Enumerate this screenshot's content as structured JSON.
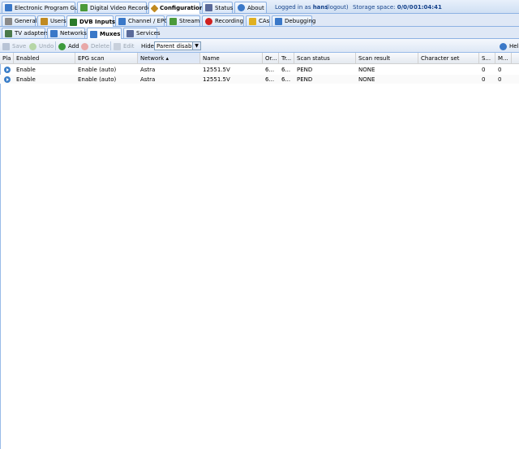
{
  "top_tabs": [
    {
      "label": "Electronic Program Guide",
      "icon": "epg-icon",
      "color": "#3a78c8"
    },
    {
      "label": "Digital Video Recorder",
      "icon": "dvr-icon",
      "color": "#4a9a3a"
    },
    {
      "label": "Configuration",
      "icon": "wrench-icon",
      "color": "#c08a20",
      "active": true
    },
    {
      "label": "Status",
      "icon": "status-icon",
      "color": "#5a6a9a"
    },
    {
      "label": "About",
      "icon": "info-icon",
      "color": "#3a78c8"
    }
  ],
  "login": {
    "prefix": "Logged in as",
    "user": "hans",
    "logout": "(logout)"
  },
  "storage": {
    "label": "Storage space:",
    "value": "0/0/0",
    "time": "01:04:41"
  },
  "config_tabs": [
    {
      "label": "General",
      "icon": "general-icon",
      "color": "#7a7a7a"
    },
    {
      "label": "Users",
      "icon": "users-icon",
      "color": "#c08a20"
    },
    {
      "label": "DVB Inputs",
      "icon": "dvb-icon",
      "color": "#2a7a2a",
      "active": true
    },
    {
      "label": "Channel / EPG",
      "icon": "channel-icon",
      "color": "#3a78c8"
    },
    {
      "label": "Stream",
      "icon": "stream-icon",
      "color": "#4a9a3a"
    },
    {
      "label": "Recording",
      "icon": "recording-icon",
      "color": "#d02020"
    },
    {
      "label": "CAs",
      "icon": "key-icon",
      "color": "#e0b020"
    },
    {
      "label": "Debugging",
      "icon": "debug-icon",
      "color": "#3a78c8"
    }
  ],
  "dvb_tabs": [
    {
      "label": "TV adapters",
      "icon": "tv-adapter-icon",
      "color": "#4a7a4a"
    },
    {
      "label": "Networks",
      "icon": "antenna-icon",
      "color": "#3a78c8"
    },
    {
      "label": "Muxes",
      "icon": "muxes-icon",
      "color": "#3a78c8",
      "active": true
    },
    {
      "label": "Services",
      "icon": "services-icon",
      "color": "#5a6a9a"
    }
  ],
  "toolbar": {
    "save": "Save",
    "undo": "Undo",
    "add": "Add",
    "delete": "Delete",
    "edit": "Edit",
    "hide_label": "Hide",
    "hide_value": "Parent disable",
    "help": "Help"
  },
  "columns": [
    "Pla",
    "Enabled",
    "EPG scan",
    "Network ▴",
    "Name",
    "Or...",
    "Tr...",
    "Scan status",
    "Scan result",
    "Character set",
    "S...",
    "M..."
  ],
  "rows": [
    {
      "enabled": "Enable",
      "epg": "Enable (auto)",
      "network": "Astra",
      "name": "12551.5V",
      "or": "6...",
      "tr": "6...",
      "scan_status": "PEND",
      "scan_result": "NONE",
      "charset": "",
      "s": "0",
      "m": "0"
    },
    {
      "enabled": "Enable",
      "epg": "Enable (auto)",
      "network": "Astra",
      "name": "12551.5V",
      "or": "6...",
      "tr": "6...",
      "scan_status": "PEND",
      "scan_result": "NONE",
      "charset": "",
      "s": "0",
      "m": "0"
    }
  ]
}
